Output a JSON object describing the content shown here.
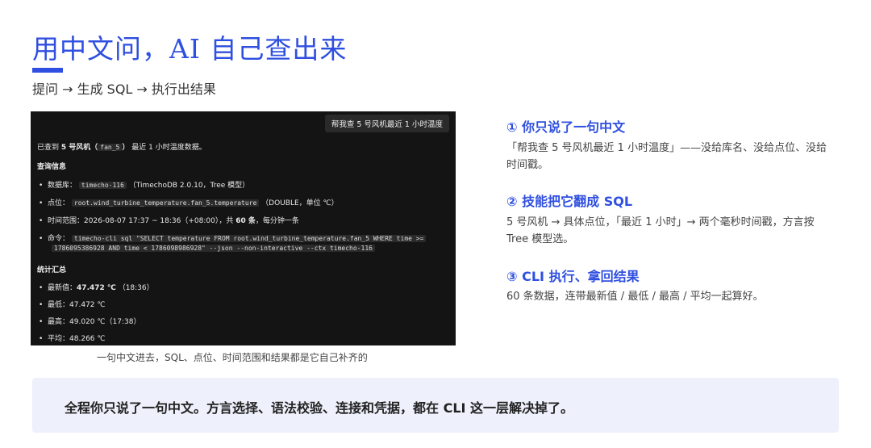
{
  "header": {
    "title": "用中文问，AI 自己查出来",
    "subtitle": "提问 → 生成 SQL → 执行出结果"
  },
  "terminal": {
    "user_prompt": "帮我查 5 号风机最近 1 小时温度",
    "intro_prefix": "已查到 ",
    "intro_bold": "5 号风机（",
    "intro_code": "fan_5",
    "intro_bold_end": "）",
    "intro_suffix": " 最近 1 小时温度数据。",
    "query_heading": "查询信息",
    "db_label": "数据库：",
    "db_code": "timecho-116",
    "db_note": "（TimechoDB 2.0.10，Tree 模型）",
    "point_label": "点位：",
    "point_code": "root.wind_turbine_temperature.fan_5.temperature",
    "point_note": "（DOUBLE，单位 ℃）",
    "range_label": "时间范围：",
    "range_text": "2026-08-07 17:37 ~ 18:36（+08:00），共 ",
    "range_count": "60 条",
    "range_suffix": "，每分钟一条",
    "cmd_label": "命令：",
    "cmd_line1": "timecho-cli sql \"SELECT temperature FROM root.wind_turbine_temperature.fan_5 WHERE time >=",
    "cmd_line2": "1786095386928 AND time < 1786098986928\" --json --non-interactive --ctx timecho-116",
    "stats_heading": "统计汇总",
    "latest_label": "最新值：",
    "latest_value": "47.472 ℃",
    "latest_time": "（18:36）",
    "min_label": "最低：",
    "min_value": "47.472 ℃",
    "max_label": "最高：",
    "max_value": "49.020 ℃（17:38）",
    "avg_label": "平均：",
    "avg_value": "48.266 ℃"
  },
  "caption": "一句中文进去，SQL、点位、时间范围和结果都是它自己补齐的",
  "points": [
    {
      "title": "① 你只说了一句中文",
      "desc": "「帮我查 5 号风机最近 1 小时温度」——没给库名、没给点位、没给时间戳。"
    },
    {
      "title": "② 技能把它翻成 SQL",
      "desc": "5 号风机 → 具体点位，「最近 1 小时」→ 两个毫秒时间戳，方言按 Tree 模型选。"
    },
    {
      "title": "③ CLI 执行、拿回结果",
      "desc": "60 条数据，连带最新值 / 最低 / 最高 / 平均一起算好。"
    }
  ],
  "footer": "全程你只说了一句中文。方言选择、语法校验、连接和凭据，都在 CLI 这一层解决掉了。",
  "colors": {
    "accent": "#2f4fe0",
    "terminal_bg": "#141414",
    "footer_bg": "#eef0fb"
  }
}
